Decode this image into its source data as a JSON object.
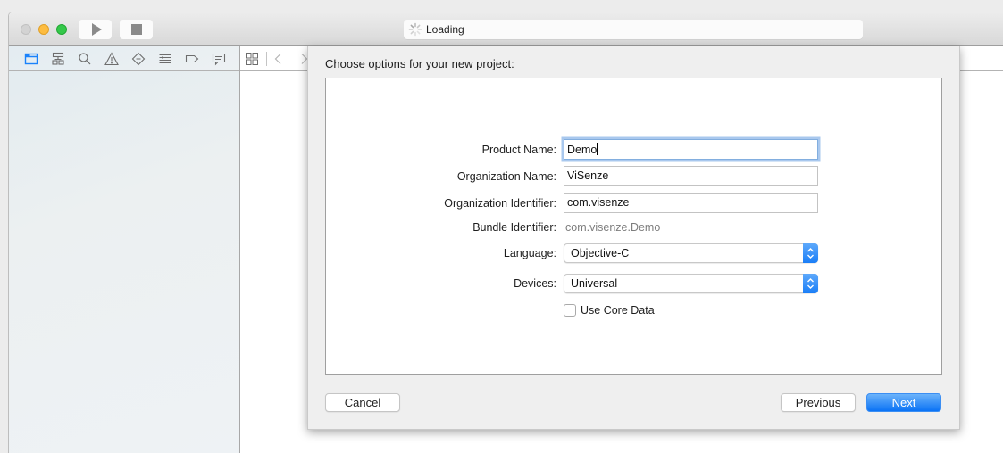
{
  "window": {
    "activity_text": "Loading",
    "toolbar": {
      "run_button": "play-icon",
      "stop_button": "stop-icon"
    }
  },
  "navigator": {
    "tabs": [
      {
        "name": "project-navigator",
        "icon": "folder-icon",
        "active": true
      },
      {
        "name": "symbol-navigator",
        "icon": "hierarchy-icon",
        "active": false
      },
      {
        "name": "find-navigator",
        "icon": "search-icon",
        "active": false
      },
      {
        "name": "issue-navigator",
        "icon": "warning-icon",
        "active": false
      },
      {
        "name": "test-navigator",
        "icon": "diamond-minus-icon",
        "active": false
      },
      {
        "name": "debug-navigator",
        "icon": "list-icon",
        "active": false
      },
      {
        "name": "breakpoint-navigator",
        "icon": "breakpoint-tag-icon",
        "active": false
      },
      {
        "name": "report-navigator",
        "icon": "speech-bubble-icon",
        "active": false
      }
    ],
    "accent_color": "#1a82fb"
  },
  "sheet": {
    "title": "Choose options for your new project:",
    "fields": {
      "product_name": {
        "label": "Product Name:",
        "value": "Demo"
      },
      "organization_name": {
        "label": "Organization Name:",
        "value": "ViSenze"
      },
      "organization_identifier": {
        "label": "Organization Identifier:",
        "value": "com.visenze"
      },
      "bundle_identifier": {
        "label": "Bundle Identifier:",
        "value": "com.visenze.Demo"
      },
      "language": {
        "label": "Language:",
        "value": "Objective-C"
      },
      "devices": {
        "label": "Devices:",
        "value": "Universal"
      },
      "use_core_data": {
        "label": "Use Core Data",
        "checked": false
      }
    },
    "buttons": {
      "cancel": "Cancel",
      "previous": "Previous",
      "next": "Next"
    }
  }
}
